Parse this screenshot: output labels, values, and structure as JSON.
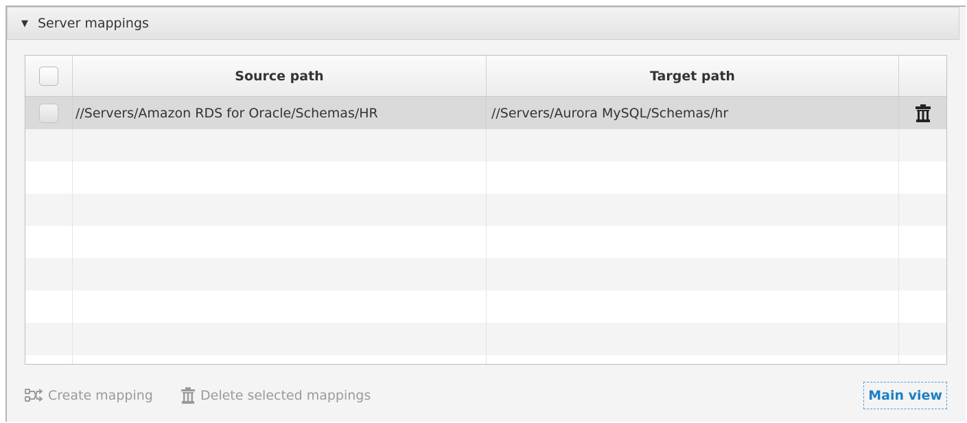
{
  "panel": {
    "title": "Server mappings",
    "collapse_icon": "triangle-down-icon"
  },
  "table": {
    "columns": {
      "select_all": "",
      "source": "Source path",
      "target": "Target path",
      "actions": ""
    },
    "rows": [
      {
        "source": "//Servers/Amazon RDS for Oracle/Schemas/HR",
        "target": "//Servers/Aurora MySQL/Schemas/hr",
        "selected": false,
        "action_icon": "trash-icon"
      }
    ],
    "empty_rows": 7
  },
  "footer": {
    "create_label": "Create mapping",
    "create_icon": "create-mapping-icon",
    "delete_label": "Delete selected mappings",
    "delete_icon": "trash-icon",
    "main_view_label": "Main view"
  },
  "colors": {
    "accent": "#1a7fc7",
    "disabled_text": "#9a9a9a",
    "selected_row": "#dadada"
  }
}
